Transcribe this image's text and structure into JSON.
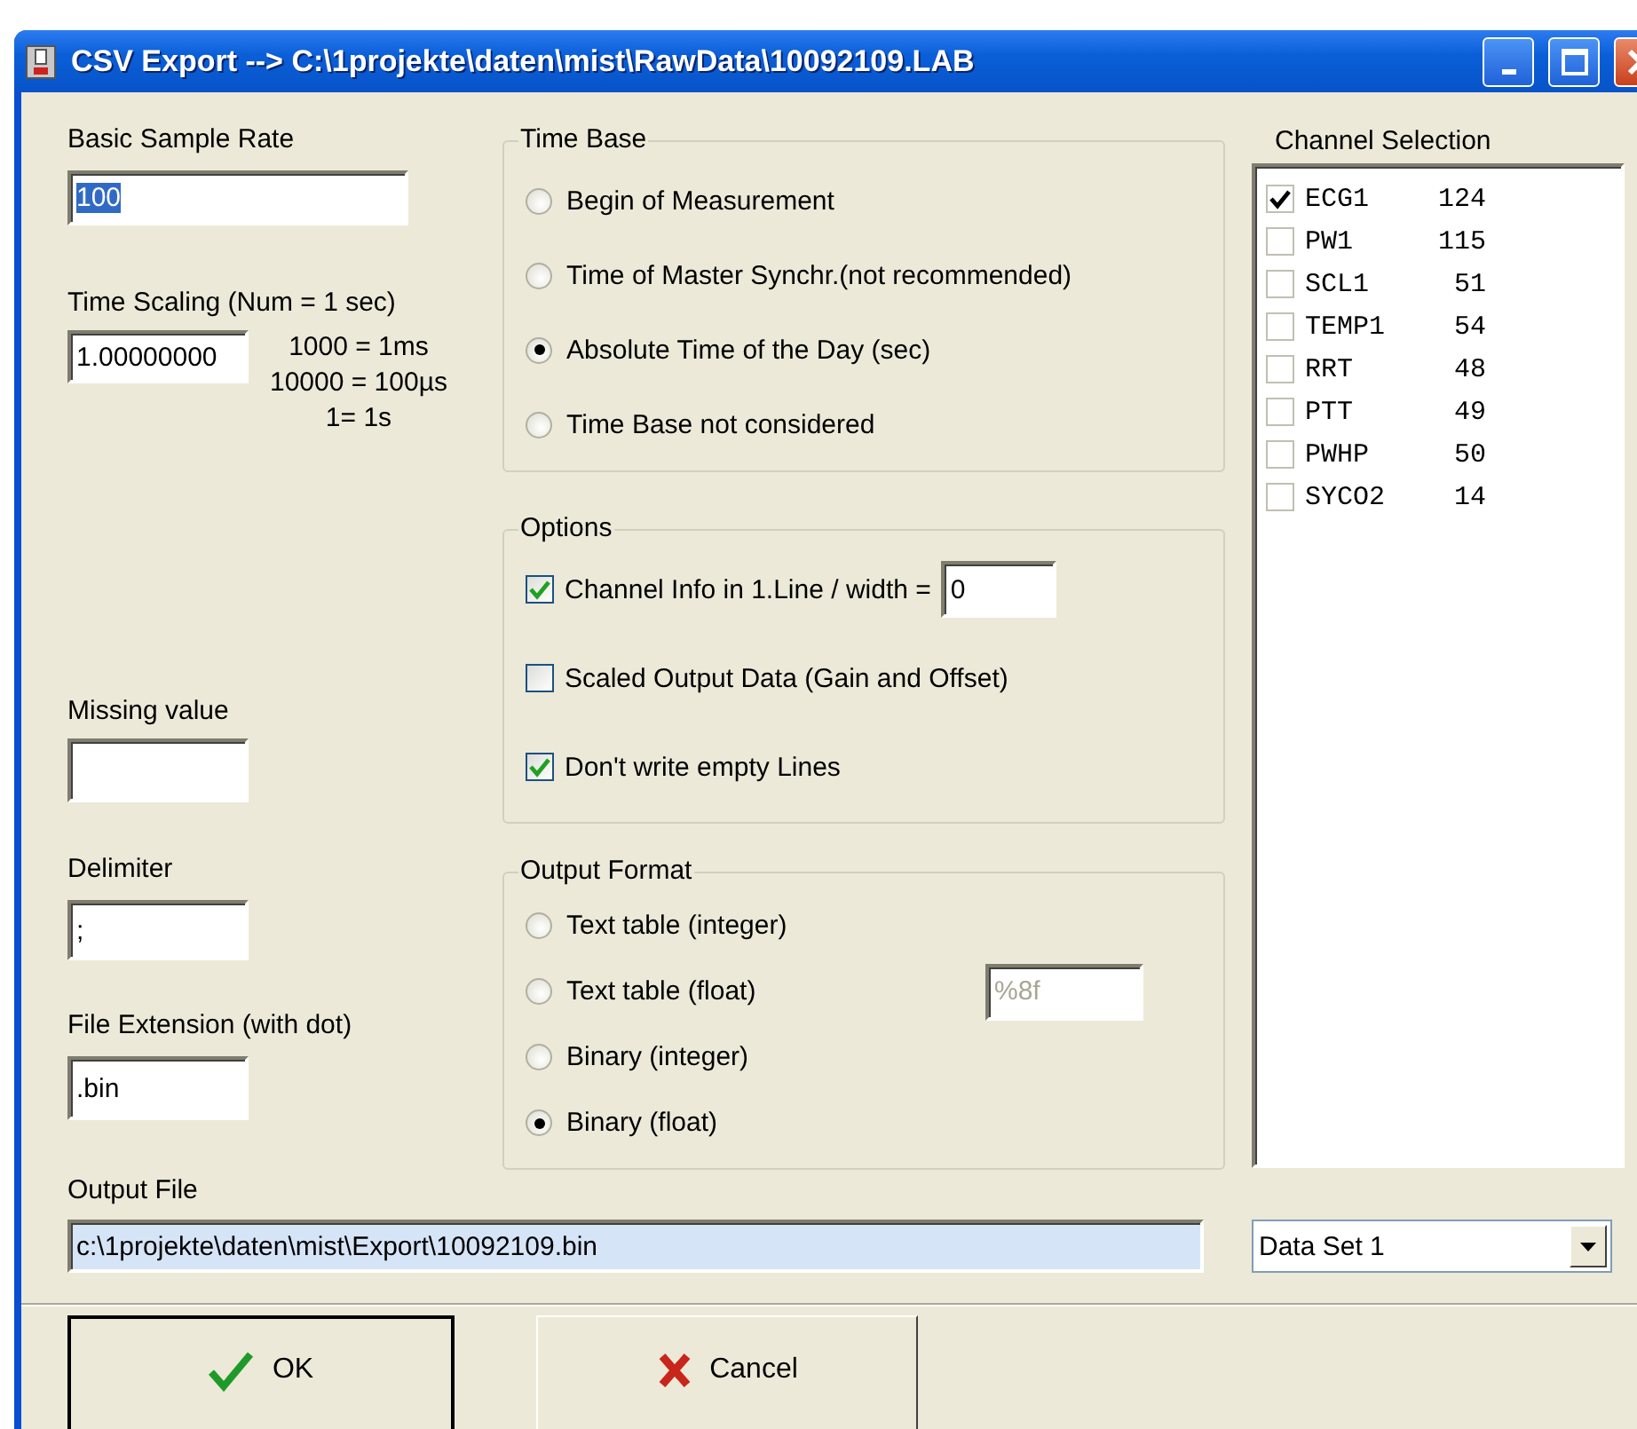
{
  "window": {
    "title": "CSV Export --> C:\\1projekte\\daten\\mist\\RawData\\10092109.LAB"
  },
  "sample_rate": {
    "label": "Basic Sample Rate",
    "value": "100",
    "selected": true
  },
  "time_scaling": {
    "label": "Time Scaling (Num = 1 sec)",
    "value": "1.00000000",
    "notes": [
      "1000 = 1ms",
      "10000 = 100µs",
      "1= 1s"
    ]
  },
  "missing_value": {
    "label": "Missing value"
  },
  "delimiter": {
    "label": "Delimiter",
    "value": ";"
  },
  "file_extension": {
    "label": "File Extension (with dot)",
    "value": ".bin"
  },
  "time_base": {
    "title": "Time Base",
    "options": [
      {
        "label": "Begin of Measurement",
        "selected": false
      },
      {
        "label": "Time of Master Synchr.(not recommended)",
        "selected": false
      },
      {
        "label": "Absolute Time of the Day (sec)",
        "selected": true
      },
      {
        "label": "Time Base not considered",
        "selected": false
      }
    ]
  },
  "options": {
    "title": "Options",
    "items": [
      {
        "label": "Channel Info in 1.Line / width =",
        "checked": true,
        "field_value": "0"
      },
      {
        "label": "Scaled Output Data (Gain and Offset)",
        "checked": false
      },
      {
        "label": "Don't write  empty Lines",
        "checked": true
      }
    ]
  },
  "output_format": {
    "title": "Output Format",
    "options": [
      {
        "label": "Text table (integer)",
        "selected": false
      },
      {
        "label": "Text table (float)",
        "selected": false,
        "field_value": "%8f",
        "field_disabled": true
      },
      {
        "label": "Binary (integer)",
        "selected": false
      },
      {
        "label": "Binary (float)",
        "selected": true
      }
    ]
  },
  "channel_selection": {
    "title": "Channel Selection",
    "channels": [
      {
        "name": "ECG1",
        "count": "124",
        "checked": true
      },
      {
        "name": "PW1",
        "count": "115",
        "checked": false
      },
      {
        "name": "SCL1",
        "count": "51",
        "checked": false
      },
      {
        "name": "TEMP1",
        "count": "54",
        "checked": false
      },
      {
        "name": "RRT",
        "count": "48",
        "checked": false
      },
      {
        "name": "PTT",
        "count": "49",
        "checked": false
      },
      {
        "name": "PWHP",
        "count": "50",
        "checked": false
      },
      {
        "name": "SYCO2",
        "count": "14",
        "checked": false
      }
    ]
  },
  "output_file": {
    "label": "Output File",
    "value": "c:\\1projekte\\daten\\mist\\Export\\10092109.bin"
  },
  "data_set": {
    "value": "Data Set 1"
  },
  "buttons": [
    {
      "label": "OK",
      "kind": "ok"
    },
    {
      "label": "Cancel",
      "kind": "cancel"
    }
  ]
}
